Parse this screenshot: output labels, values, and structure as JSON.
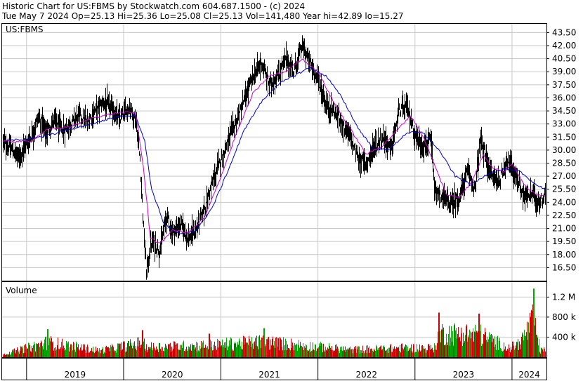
{
  "header": {
    "line1": "Historic Chart for US:FBMS by Stockwatch.com 604.687.1500 - (c) 2024",
    "line2": "Tue May  7 2024   Op=25.13  Hi=25.36  Lo=25.08  Cl=25.13  Vol=141,480  Year hi=42.89  lo=15.27"
  },
  "chart_data": [
    {
      "type": "candlestick",
      "title": "US:FBMS",
      "ylim": [
        15.0,
        44.5
      ],
      "yticks": [
        "43.50",
        "42.00",
        "40.50",
        "39.00",
        "37.50",
        "36.00",
        "34.50",
        "33.00",
        "31.50",
        "30.00",
        "28.50",
        "27.00",
        "25.50",
        "24.00",
        "22.50",
        "21.00",
        "19.50",
        "18.00",
        "16.50"
      ],
      "x_years": [
        "2019",
        "2020",
        "2021",
        "2022",
        "2023",
        "2024"
      ],
      "year_starts": [
        "2019-01-01",
        "2020-01-01",
        "2021-01-01",
        "2022-01-01",
        "2023-01-01",
        "2024-01-01"
      ],
      "x_range": [
        "2018-10-01",
        "2024-05-07"
      ],
      "colors": {
        "price": "#000000",
        "ma_short": "#cc00cc",
        "ma_long": "#0000cc",
        "grid": "#c8c8c8"
      },
      "price_series": [
        [
          "2018-10-01",
          31.0
        ],
        [
          "2018-11-01",
          30.2
        ],
        [
          "2018-12-01",
          29.2
        ],
        [
          "2019-01-15",
          31.5
        ],
        [
          "2019-02-15",
          33.8
        ],
        [
          "2019-03-15",
          32.0
        ],
        [
          "2019-04-15",
          33.5
        ],
        [
          "2019-05-15",
          32.2
        ],
        [
          "2019-06-15",
          33.0
        ],
        [
          "2019-07-15",
          34.0
        ],
        [
          "2019-08-15",
          33.2
        ],
        [
          "2019-09-15",
          34.5
        ],
        [
          "2019-10-15",
          35.5
        ],
        [
          "2019-11-15",
          34.8
        ],
        [
          "2019-12-15",
          33.5
        ],
        [
          "2020-01-20",
          35.0
        ],
        [
          "2020-02-15",
          33.5
        ],
        [
          "2020-03-01",
          29.0
        ],
        [
          "2020-03-15",
          21.0
        ],
        [
          "2020-03-25",
          16.0
        ],
        [
          "2020-04-15",
          19.5
        ],
        [
          "2020-05-15",
          18.5
        ],
        [
          "2020-06-10",
          22.5
        ],
        [
          "2020-07-01",
          20.5
        ],
        [
          "2020-08-01",
          21.5
        ],
        [
          "2020-09-01",
          19.8
        ],
        [
          "2020-10-01",
          21.0
        ],
        [
          "2020-11-01",
          23.5
        ],
        [
          "2020-12-01",
          26.5
        ],
        [
          "2021-01-01",
          29.0
        ],
        [
          "2021-02-01",
          31.5
        ],
        [
          "2021-03-01",
          33.5
        ],
        [
          "2021-04-01",
          36.0
        ],
        [
          "2021-05-01",
          38.5
        ],
        [
          "2021-06-01",
          40.0
        ],
        [
          "2021-07-01",
          37.5
        ],
        [
          "2021-08-01",
          38.5
        ],
        [
          "2021-09-01",
          40.5
        ],
        [
          "2021-10-01",
          39.0
        ],
        [
          "2021-11-01",
          42.0
        ],
        [
          "2021-12-01",
          40.0
        ],
        [
          "2022-01-01",
          38.0
        ],
        [
          "2022-02-01",
          35.0
        ],
        [
          "2022-03-01",
          34.5
        ],
        [
          "2022-04-01",
          33.0
        ],
        [
          "2022-05-01",
          31.5
        ],
        [
          "2022-06-01",
          29.0
        ],
        [
          "2022-07-01",
          28.5
        ],
        [
          "2022-08-01",
          30.5
        ],
        [
          "2022-09-01",
          31.5
        ],
        [
          "2022-10-01",
          30.0
        ],
        [
          "2022-11-01",
          34.5
        ],
        [
          "2022-12-01",
          35.0
        ],
        [
          "2023-01-01",
          31.5
        ],
        [
          "2023-02-01",
          30.5
        ],
        [
          "2023-03-01",
          31.0
        ],
        [
          "2023-03-15",
          25.0
        ],
        [
          "2023-04-15",
          24.5
        ],
        [
          "2023-05-15",
          23.8
        ],
        [
          "2023-06-15",
          24.5
        ],
        [
          "2023-07-15",
          27.5
        ],
        [
          "2023-08-15",
          25.5
        ],
        [
          "2023-09-01",
          31.0
        ],
        [
          "2023-09-20",
          29.5
        ],
        [
          "2023-10-15",
          27.0
        ],
        [
          "2023-11-15",
          26.5
        ],
        [
          "2023-12-10",
          29.0
        ],
        [
          "2023-12-20",
          28.5
        ],
        [
          "2024-01-15",
          27.0
        ],
        [
          "2024-02-15",
          24.5
        ],
        [
          "2024-03-15",
          25.0
        ],
        [
          "2024-04-15",
          24.0
        ],
        [
          "2024-05-07",
          25.13
        ]
      ],
      "ma_short": [
        [
          "2018-10-01",
          31.0
        ],
        [
          "2019-01-15",
          31.0
        ],
        [
          "2019-03-15",
          32.3
        ],
        [
          "2019-06-15",
          32.7
        ],
        [
          "2019-09-15",
          33.8
        ],
        [
          "2019-12-15",
          34.3
        ],
        [
          "2020-02-15",
          34.3
        ],
        [
          "2020-03-15",
          28.0
        ],
        [
          "2020-04-10",
          20.0
        ],
        [
          "2020-05-15",
          19.2
        ],
        [
          "2020-07-01",
          20.8
        ],
        [
          "2020-09-01",
          20.5
        ],
        [
          "2020-11-01",
          22.3
        ],
        [
          "2021-01-01",
          27.0
        ],
        [
          "2021-03-01",
          32.0
        ],
        [
          "2021-05-01",
          36.5
        ],
        [
          "2021-07-01",
          38.5
        ],
        [
          "2021-09-01",
          39.0
        ],
        [
          "2021-11-01",
          40.5
        ],
        [
          "2022-01-01",
          39.0
        ],
        [
          "2022-03-01",
          35.5
        ],
        [
          "2022-05-01",
          32.5
        ],
        [
          "2022-07-01",
          29.5
        ],
        [
          "2022-09-01",
          30.5
        ],
        [
          "2022-11-01",
          32.5
        ],
        [
          "2022-12-15",
          34.0
        ],
        [
          "2023-02-01",
          31.5
        ],
        [
          "2023-03-25",
          27.5
        ],
        [
          "2023-05-01",
          24.8
        ],
        [
          "2023-06-15",
          24.6
        ],
        [
          "2023-08-01",
          26.3
        ],
        [
          "2023-09-15",
          29.5
        ],
        [
          "2023-10-20",
          28.0
        ],
        [
          "2023-12-01",
          27.5
        ],
        [
          "2024-01-01",
          28.5
        ],
        [
          "2024-02-15",
          26.0
        ],
        [
          "2024-04-01",
          24.8
        ],
        [
          "2024-05-07",
          24.9
        ]
      ],
      "ma_long": [
        [
          "2018-10-01",
          31.0
        ],
        [
          "2019-03-01",
          31.5
        ],
        [
          "2019-06-01",
          32.3
        ],
        [
          "2019-09-01",
          33.0
        ],
        [
          "2019-12-01",
          33.8
        ],
        [
          "2020-02-15",
          34.0
        ],
        [
          "2020-03-20",
          31.0
        ],
        [
          "2020-04-15",
          25.5
        ],
        [
          "2020-06-01",
          21.5
        ],
        [
          "2020-08-01",
          20.3
        ],
        [
          "2020-10-01",
          20.8
        ],
        [
          "2020-12-01",
          23.5
        ],
        [
          "2021-02-01",
          28.0
        ],
        [
          "2021-04-01",
          32.5
        ],
        [
          "2021-06-01",
          35.5
        ],
        [
          "2021-08-01",
          37.5
        ],
        [
          "2021-10-01",
          38.5
        ],
        [
          "2021-12-01",
          39.5
        ],
        [
          "2022-02-01",
          38.5
        ],
        [
          "2022-04-01",
          36.0
        ],
        [
          "2022-06-01",
          32.5
        ],
        [
          "2022-08-01",
          30.0
        ],
        [
          "2022-10-01",
          30.2
        ],
        [
          "2022-12-01",
          32.0
        ],
        [
          "2023-02-01",
          32.0
        ],
        [
          "2023-04-01",
          30.0
        ],
        [
          "2023-06-01",
          27.0
        ],
        [
          "2023-08-01",
          26.0
        ],
        [
          "2023-10-01",
          27.3
        ],
        [
          "2023-12-01",
          27.8
        ],
        [
          "2024-02-01",
          27.5
        ],
        [
          "2024-04-01",
          26.0
        ],
        [
          "2024-05-07",
          25.5
        ]
      ]
    },
    {
      "type": "bar",
      "title": "Volume",
      "yticks": [
        "1.2 M",
        "800 k",
        "400 k"
      ],
      "ylim": [
        0,
        1500000
      ],
      "series": [
        {
          "values_points": [
            [
              "2018-10-01",
              100000
            ],
            [
              "2019-03-20",
              560000
            ],
            [
              "2019-10-01",
              250000
            ],
            [
              "2020-03-10",
              540000
            ],
            [
              "2020-03-25",
              380000
            ],
            [
              "2020-11-15",
              450000
            ],
            [
              "2021-06-10",
              580000
            ],
            [
              "2022-05-01",
              280000
            ],
            [
              "2022-11-05",
              350000
            ],
            [
              "2023-03-15",
              350000
            ],
            [
              "2023-03-31",
              890000
            ],
            [
              "2023-08-28",
              870000
            ],
            [
              "2023-12-20",
              330000
            ],
            [
              "2024-01-30",
              550000
            ],
            [
              "2024-03-20",
              1370000
            ],
            [
              "2024-04-15",
              250000
            ]
          ]
        }
      ]
    }
  ]
}
